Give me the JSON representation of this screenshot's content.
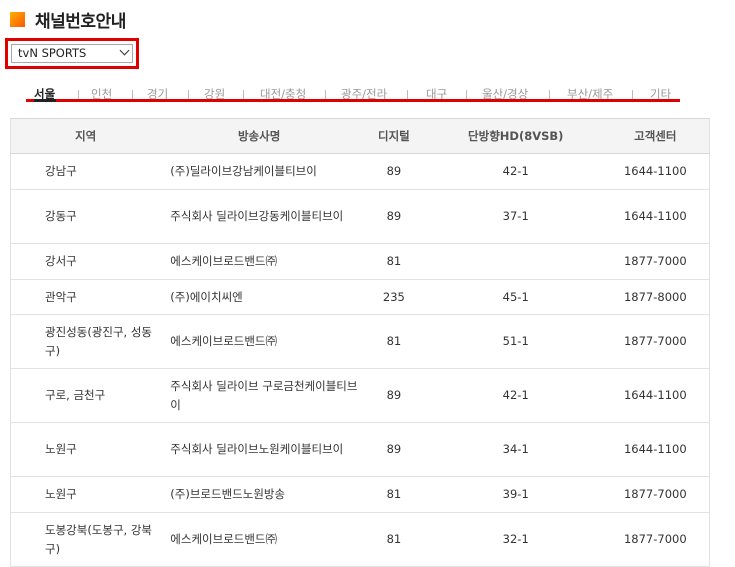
{
  "page": {
    "title": "채널번호안내"
  },
  "channel_select": {
    "selected": "tvN SPORTS"
  },
  "tabs": [
    "서울",
    "인천",
    "경기",
    "강원",
    "대전/충청",
    "광주/전라",
    "대구",
    "울산/경상",
    "부산/제주",
    "기타"
  ],
  "table": {
    "headers": [
      "지역",
      "방송사명",
      "디지털",
      "단방향HD(8VSB)",
      "고객센터"
    ],
    "rows": [
      [
        "강남구",
        "(주)딜라이브강남케이블티브이",
        "89",
        "42-1",
        "1644-1100"
      ],
      [
        "강동구",
        "주식회사 딜라이브강동케이블티브이",
        "89",
        "37-1",
        "1644-1100"
      ],
      [
        "강서구",
        "에스케이브로드밴드㈜",
        "81",
        "",
        "1877-7000"
      ],
      [
        "관악구",
        "(주)에이치씨엔",
        "235",
        "45-1",
        "1877-8000"
      ],
      [
        "광진성동(광진구, 성동구)",
        "에스케이브로드밴드㈜",
        "81",
        "51-1",
        "1877-7000"
      ],
      [
        "구로, 금천구",
        "주식회사 딜라이브 구로금천케이블티브이",
        "89",
        "42-1",
        "1644-1100"
      ],
      [
        "노원구",
        "주식회사 딜라이브노원케이블티브이",
        "89",
        "34-1",
        "1644-1100"
      ],
      [
        "노원구",
        "(주)브로드밴드노원방송",
        "81",
        "39-1",
        "1877-7000"
      ],
      [
        "도봉강북(도봉구, 강북구)",
        "에스케이브로드밴드㈜",
        "81",
        "32-1",
        "1877-7000"
      ]
    ]
  }
}
